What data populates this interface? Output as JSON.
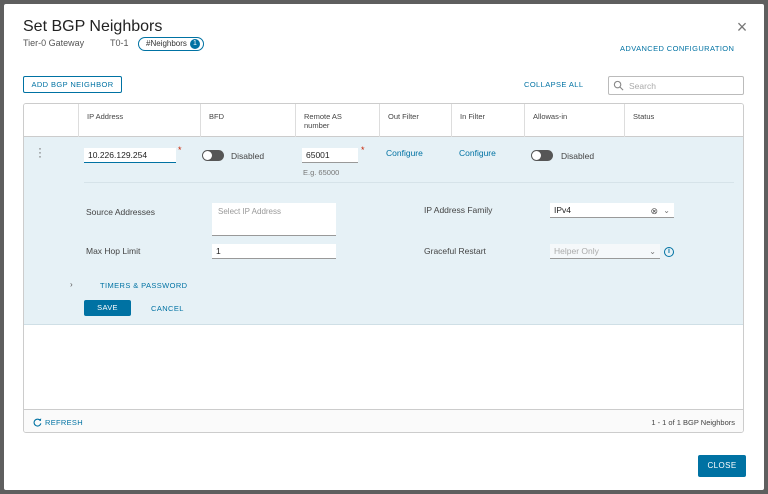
{
  "dialog": {
    "title": "Set BGP Neighbors",
    "close_icon": "×",
    "gateway_label": "Tier-0 Gateway",
    "gateway_name": "T0-1",
    "tag_label": "#Neighbors",
    "tag_count": "1",
    "advanced_config": "ADVANCED CONFIGURATION"
  },
  "toolbar": {
    "add_label": "ADD BGP NEIGHBOR",
    "collapse_label": "COLLAPSE ALL",
    "search_placeholder": "Search"
  },
  "table": {
    "headers": [
      "IP Address",
      "BFD",
      "Remote AS\nnumber",
      "Out Filter",
      "In Filter",
      "Allowas-in",
      "Status"
    ]
  },
  "row": {
    "ip_address": "10.226.129.254",
    "required_mark": "*",
    "bfd_state": "Disabled",
    "remote_as": "65001",
    "remote_as_hint": "E.g. 65000",
    "out_filter": "Configure",
    "in_filter": "Configure",
    "allowas_state": "Disabled"
  },
  "details": {
    "source_addresses_label": "Source Addresses",
    "source_addresses_placeholder": "Select IP Address",
    "max_hop_label": "Max Hop Limit",
    "max_hop_value": "1",
    "ip_family_label": "IP Address Family",
    "ip_family_value": "IPv4",
    "graceful_label": "Graceful Restart",
    "graceful_value": "Helper Only",
    "timers_label": "TIMERS & PASSWORD",
    "save_label": "SAVE",
    "cancel_label": "CANCEL"
  },
  "footer": {
    "refresh_label": "REFRESH",
    "count_text": "1 - 1 of 1 BGP Neighbors",
    "close_label": "CLOSE"
  },
  "colors": {
    "accent": "#0072a3",
    "row_bg": "#e6f1f6",
    "required": "#c92100",
    "overlay": "#5f5f5f"
  }
}
